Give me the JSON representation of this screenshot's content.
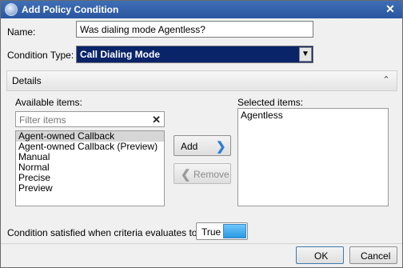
{
  "window": {
    "title": "Add Policy Condition",
    "close_glyph": "✕"
  },
  "form": {
    "name_label": "Name:",
    "name_value": "Was dialing mode Agentless?",
    "condition_type_label": "Condition Type:",
    "condition_type_value": "Call Dialing Mode",
    "combo_arrow": "▼"
  },
  "details": {
    "header": "Details",
    "collapse_glyph": "⌃",
    "available_label": "Available items:",
    "selected_label": "Selected items:",
    "filter_placeholder": "Filter items",
    "filter_clear_glyph": "✕",
    "available_items": [
      "Agent-owned Callback",
      "Agent-owned Callback (Preview)",
      "Manual",
      "Normal",
      "Precise",
      "Preview"
    ],
    "selected_items": [
      "Agentless"
    ],
    "add_label": "Add",
    "add_glyph": "❯",
    "remove_label": "Remove",
    "remove_glyph": "❮"
  },
  "criteria": {
    "label": "Condition satisfied when criteria evaluates to:",
    "value": "True"
  },
  "footer": {
    "ok_label": "OK",
    "cancel_label": "Cancel"
  },
  "colors": {
    "accent": "#2a9ae0",
    "title_bar": "#2a56a0",
    "combo_selection": "#0a246a"
  }
}
